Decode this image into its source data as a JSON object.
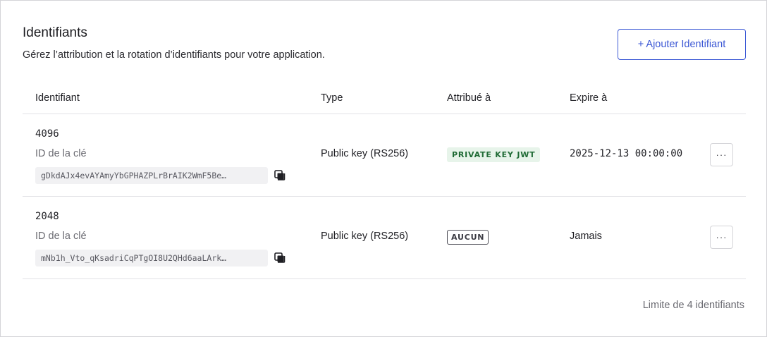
{
  "header": {
    "title": "Identifiants",
    "subtitle": "Gérez l’attribution et la rotation d’identifiants pour votre application.",
    "add_button": "+ Ajouter Identifiant"
  },
  "table": {
    "columns": [
      "Identifiant",
      "Type",
      "Attribué à",
      "Expire à"
    ],
    "rows": [
      {
        "size": "4096",
        "key_label": "ID de la clé",
        "key_id": "gDkdAJx4evAYAmyYbGPHAZPLrBrAIK2WmF5Be…",
        "type": "Public key (RS256)",
        "assigned": "PRIVATE KEY JWT",
        "expires": "2025-12-13 00:00:00",
        "more": "···"
      },
      {
        "size": "2048",
        "key_label": "ID de la clé",
        "key_id": "mNb1h_Vto_qKsadriCqPTgOI8U2QHd6aaLArk…",
        "type": "Public key (RS256)",
        "assigned": "AUCUN",
        "expires": "Jamais",
        "more": "···"
      }
    ]
  },
  "footer": {
    "limit_text": "Limite de 4 identifiants"
  },
  "colors": {
    "accent": "#3a56d4",
    "badge_green_bg": "#e7f4ea",
    "badge_green_text": "#1f6b35",
    "border": "#d4d4d8"
  },
  "icons": {
    "copy": "copy-icon",
    "more": "more-horizontal-icon"
  }
}
